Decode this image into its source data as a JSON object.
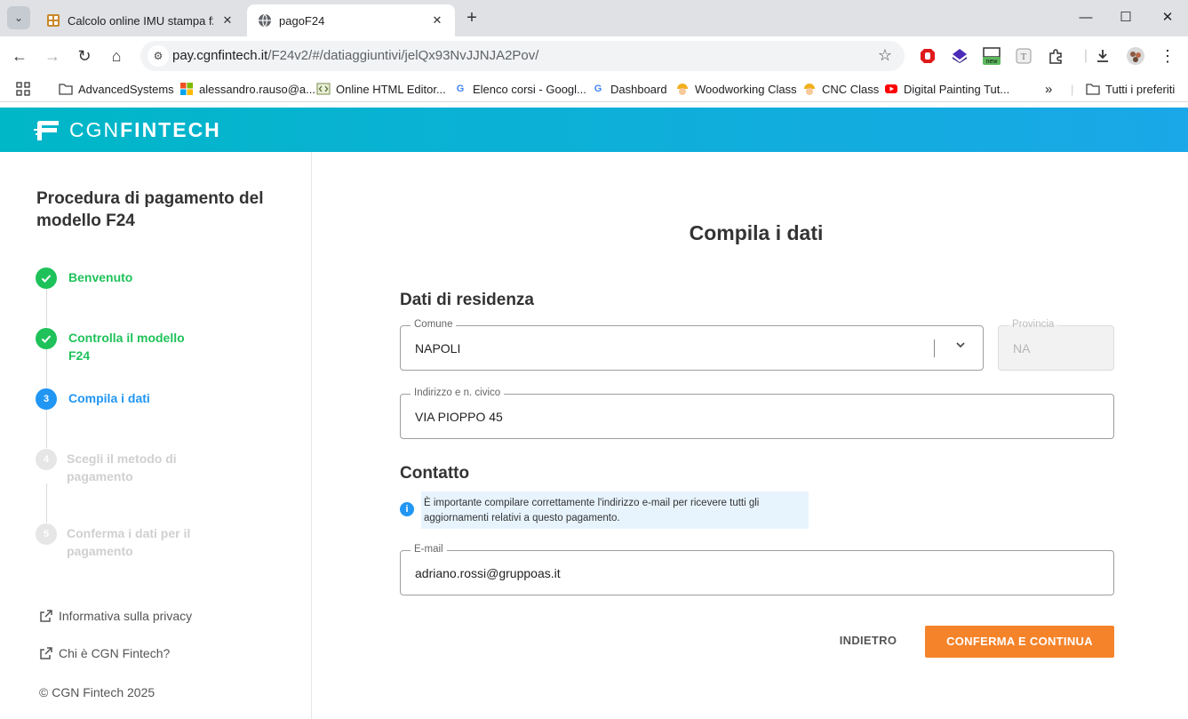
{
  "browser": {
    "tabs": [
      {
        "title": "Calcolo online IMU stampa f24",
        "active": false
      },
      {
        "title": "pagoF24",
        "active": true
      }
    ],
    "url_host": "pay.cgnfintech.it",
    "url_path": "/F24v2/#/datiaggiuntivi/jelQx93NvJJNJA2Pov/",
    "extension_badge": "new",
    "bookmarks": [
      {
        "label": "AdvancedSystems",
        "icon": "folder-icon"
      },
      {
        "label": "alessandro.rauso@a...",
        "icon": "microsoft-icon"
      },
      {
        "label": "Online HTML Editor...",
        "icon": "code-icon"
      },
      {
        "label": "Elenco corsi - Googl...",
        "icon": "google-icon"
      },
      {
        "label": "Dashboard",
        "icon": "google-icon"
      },
      {
        "label": "Woodworking Class",
        "icon": "worker-icon"
      },
      {
        "label": "CNC Class",
        "icon": "worker-icon"
      },
      {
        "label": "Digital Painting Tut...",
        "icon": "youtube-icon"
      }
    ],
    "bookmarks_overflow": "»",
    "all_bookmarks": "Tutti i preferiti"
  },
  "brand": {
    "light": "CGN",
    "bold": "FINTECH",
    "color_from": "#00b7c7",
    "color_to": "#1aa8e8"
  },
  "sidebar": {
    "title": "Procedura di pagamento del modello F24",
    "steps": [
      {
        "label": "Benvenuto",
        "state": "done",
        "marker": "✓"
      },
      {
        "label": "Controlla il modello F24",
        "state": "done",
        "marker": "✓"
      },
      {
        "label": "Compila i dati",
        "state": "active",
        "marker": "3"
      },
      {
        "label": "Scegli il metodo di pagamento",
        "state": "todo",
        "marker": "4"
      },
      {
        "label": "Conferma i dati per il pagamento",
        "state": "todo",
        "marker": "5"
      }
    ],
    "links": [
      "Informativa sulla privacy",
      "Chi è CGN Fintech?"
    ],
    "copyright": "© CGN Fintech 2025"
  },
  "main": {
    "title": "Compila i dati",
    "residence_title": "Dati di residenza",
    "comune": {
      "label": "Comune",
      "value": "NAPOLI"
    },
    "provincia": {
      "label": "Provincia",
      "value": "NA"
    },
    "indirizzo": {
      "label": "Indirizzo e n. civico",
      "value": "VIA PIOPPO 45"
    },
    "contact_title": "Contatto",
    "info": "È importante compilare correttamente l'indirizzo e-mail per ricevere tutti gli aggiornamenti relativi a questo pagamento.",
    "email": {
      "label": "E-mail",
      "value": "adriano.rossi@gruppoas.it"
    },
    "back_button": "INDIETRO",
    "confirm_button": "CONFERMA E CONTINUA",
    "accent_color": "#f5832a",
    "done_color": "#1fc25a",
    "active_color": "#2196f3"
  }
}
